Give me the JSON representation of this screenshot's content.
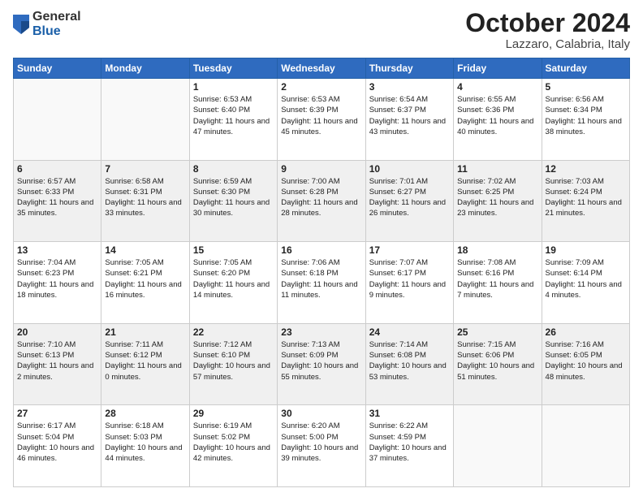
{
  "logo": {
    "general": "General",
    "blue": "Blue"
  },
  "header": {
    "month_year": "October 2024",
    "location": "Lazzaro, Calabria, Italy"
  },
  "days_of_week": [
    "Sunday",
    "Monday",
    "Tuesday",
    "Wednesday",
    "Thursday",
    "Friday",
    "Saturday"
  ],
  "weeks": [
    {
      "shaded": false,
      "days": [
        {
          "date": "",
          "content": ""
        },
        {
          "date": "",
          "content": ""
        },
        {
          "date": "1",
          "content": "Sunrise: 6:53 AM\nSunset: 6:40 PM\nDaylight: 11 hours and 47 minutes."
        },
        {
          "date": "2",
          "content": "Sunrise: 6:53 AM\nSunset: 6:39 PM\nDaylight: 11 hours and 45 minutes."
        },
        {
          "date": "3",
          "content": "Sunrise: 6:54 AM\nSunset: 6:37 PM\nDaylight: 11 hours and 43 minutes."
        },
        {
          "date": "4",
          "content": "Sunrise: 6:55 AM\nSunset: 6:36 PM\nDaylight: 11 hours and 40 minutes."
        },
        {
          "date": "5",
          "content": "Sunrise: 6:56 AM\nSunset: 6:34 PM\nDaylight: 11 hours and 38 minutes."
        }
      ]
    },
    {
      "shaded": true,
      "days": [
        {
          "date": "6",
          "content": "Sunrise: 6:57 AM\nSunset: 6:33 PM\nDaylight: 11 hours and 35 minutes."
        },
        {
          "date": "7",
          "content": "Sunrise: 6:58 AM\nSunset: 6:31 PM\nDaylight: 11 hours and 33 minutes."
        },
        {
          "date": "8",
          "content": "Sunrise: 6:59 AM\nSunset: 6:30 PM\nDaylight: 11 hours and 30 minutes."
        },
        {
          "date": "9",
          "content": "Sunrise: 7:00 AM\nSunset: 6:28 PM\nDaylight: 11 hours and 28 minutes."
        },
        {
          "date": "10",
          "content": "Sunrise: 7:01 AM\nSunset: 6:27 PM\nDaylight: 11 hours and 26 minutes."
        },
        {
          "date": "11",
          "content": "Sunrise: 7:02 AM\nSunset: 6:25 PM\nDaylight: 11 hours and 23 minutes."
        },
        {
          "date": "12",
          "content": "Sunrise: 7:03 AM\nSunset: 6:24 PM\nDaylight: 11 hours and 21 minutes."
        }
      ]
    },
    {
      "shaded": false,
      "days": [
        {
          "date": "13",
          "content": "Sunrise: 7:04 AM\nSunset: 6:23 PM\nDaylight: 11 hours and 18 minutes."
        },
        {
          "date": "14",
          "content": "Sunrise: 7:05 AM\nSunset: 6:21 PM\nDaylight: 11 hours and 16 minutes."
        },
        {
          "date": "15",
          "content": "Sunrise: 7:05 AM\nSunset: 6:20 PM\nDaylight: 11 hours and 14 minutes."
        },
        {
          "date": "16",
          "content": "Sunrise: 7:06 AM\nSunset: 6:18 PM\nDaylight: 11 hours and 11 minutes."
        },
        {
          "date": "17",
          "content": "Sunrise: 7:07 AM\nSunset: 6:17 PM\nDaylight: 11 hours and 9 minutes."
        },
        {
          "date": "18",
          "content": "Sunrise: 7:08 AM\nSunset: 6:16 PM\nDaylight: 11 hours and 7 minutes."
        },
        {
          "date": "19",
          "content": "Sunrise: 7:09 AM\nSunset: 6:14 PM\nDaylight: 11 hours and 4 minutes."
        }
      ]
    },
    {
      "shaded": true,
      "days": [
        {
          "date": "20",
          "content": "Sunrise: 7:10 AM\nSunset: 6:13 PM\nDaylight: 11 hours and 2 minutes."
        },
        {
          "date": "21",
          "content": "Sunrise: 7:11 AM\nSunset: 6:12 PM\nDaylight: 11 hours and 0 minutes."
        },
        {
          "date": "22",
          "content": "Sunrise: 7:12 AM\nSunset: 6:10 PM\nDaylight: 10 hours and 57 minutes."
        },
        {
          "date": "23",
          "content": "Sunrise: 7:13 AM\nSunset: 6:09 PM\nDaylight: 10 hours and 55 minutes."
        },
        {
          "date": "24",
          "content": "Sunrise: 7:14 AM\nSunset: 6:08 PM\nDaylight: 10 hours and 53 minutes."
        },
        {
          "date": "25",
          "content": "Sunrise: 7:15 AM\nSunset: 6:06 PM\nDaylight: 10 hours and 51 minutes."
        },
        {
          "date": "26",
          "content": "Sunrise: 7:16 AM\nSunset: 6:05 PM\nDaylight: 10 hours and 48 minutes."
        }
      ]
    },
    {
      "shaded": false,
      "days": [
        {
          "date": "27",
          "content": "Sunrise: 6:17 AM\nSunset: 5:04 PM\nDaylight: 10 hours and 46 minutes."
        },
        {
          "date": "28",
          "content": "Sunrise: 6:18 AM\nSunset: 5:03 PM\nDaylight: 10 hours and 44 minutes."
        },
        {
          "date": "29",
          "content": "Sunrise: 6:19 AM\nSunset: 5:02 PM\nDaylight: 10 hours and 42 minutes."
        },
        {
          "date": "30",
          "content": "Sunrise: 6:20 AM\nSunset: 5:00 PM\nDaylight: 10 hours and 39 minutes."
        },
        {
          "date": "31",
          "content": "Sunrise: 6:22 AM\nSunset: 4:59 PM\nDaylight: 10 hours and 37 minutes."
        },
        {
          "date": "",
          "content": ""
        },
        {
          "date": "",
          "content": ""
        }
      ]
    }
  ]
}
